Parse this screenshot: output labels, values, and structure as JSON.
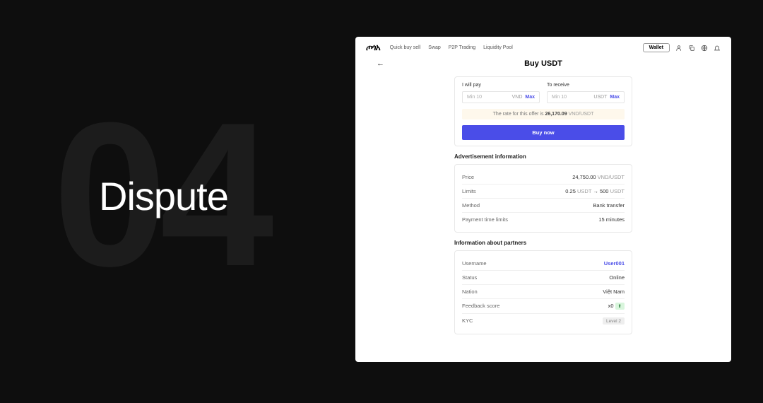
{
  "slide": {
    "number": "04",
    "title": "Dispute"
  },
  "nav": {
    "items": [
      "Quick buy sell",
      "Swap",
      "P2P Trading",
      "Liquidity Pool"
    ],
    "wallet": "Wallet"
  },
  "page": {
    "title": "Buy USDT"
  },
  "exchange": {
    "pay_label": "I will pay",
    "receive_label": "To receive",
    "pay_placeholder": "Min 10",
    "receive_placeholder": "Min 10",
    "pay_unit": "VND",
    "receive_unit": "USDT",
    "max": "Max",
    "rate_prefix": "The rate for this offer is ",
    "rate_value": "26,170.09",
    "rate_unit": "VND/USDT",
    "buy_button": "Buy now"
  },
  "ad_info": {
    "title": "Advertisement information",
    "rows": [
      {
        "label": "Price",
        "value": "24,750.00",
        "unit": "VND/USDT"
      },
      {
        "label": "Limits",
        "value_a": "0.25",
        "unit_a": "USDT",
        "arrow": "→",
        "value_b": "500",
        "unit_b": "USDT"
      },
      {
        "label": "Method",
        "value": "Bank transfer"
      },
      {
        "label": "Payment time limits",
        "value": "15 minutes"
      }
    ]
  },
  "partner": {
    "title": "Information about partners",
    "rows": {
      "username_label": "Username",
      "username_value": "User001",
      "status_label": "Status",
      "status_value": "Online",
      "nation_label": "Nation",
      "nation_value": "Việt Nam",
      "feedback_label": "Feedback score",
      "feedback_value": "x0",
      "feedback_badge": "⬆",
      "kyc_label": "KYC",
      "kyc_value": "Level 2"
    }
  }
}
